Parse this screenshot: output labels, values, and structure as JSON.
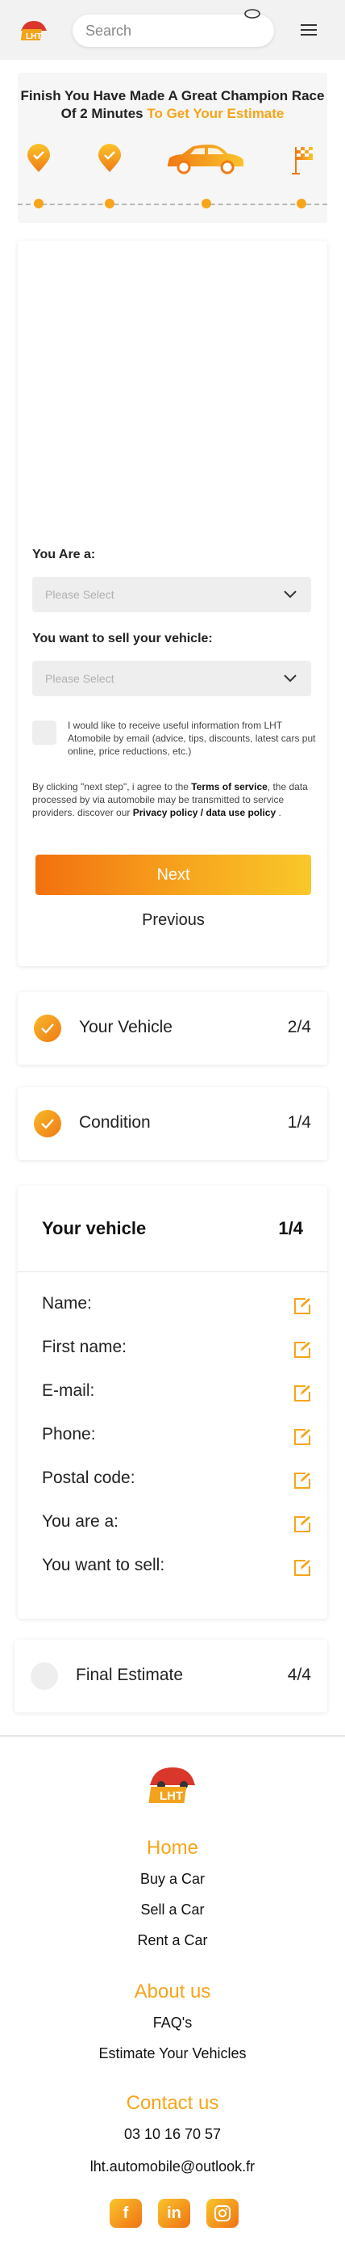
{
  "header": {
    "search_placeholder": "Search",
    "logo_icon": "lht-car-logo",
    "menu_icon": "hamburger-menu-icon"
  },
  "progress": {
    "title_main": "Finish You Have Made A Great Champion Race Of 2 Minutes",
    "title_highlight": "To Get Your Estimate",
    "accent_color": "#f5a51a"
  },
  "form": {
    "you_are_label": "You Are a:",
    "you_are_placeholder": "Please Select",
    "sell_label": "You want to sell your vehicle:",
    "sell_placeholder": "Please Select",
    "newsletter_text": "I would like to receive useful information from LHT Atomobile by email (advice, tips, discounts, latest cars put online, price reductions, etc.)",
    "legal_prefix": "By clicking \"next step\", i agree to the",
    "terms_link": "Terms of service",
    "legal_middle": ", the data processed by via automobile may be transmitted to service providers. discover our",
    "privacy_link": "Privacy policy / data use policy",
    "legal_suffix": ".",
    "next_label": "Next",
    "previous_label": "Previous"
  },
  "steps": [
    {
      "name": "Your Vehicle",
      "count": "2/4"
    },
    {
      "name": "Condition",
      "count": "1/4"
    }
  ],
  "vehicle": {
    "title": "Your vehicle",
    "count": "1/4",
    "fields": [
      "Name:",
      "First name:",
      "E-mail:",
      "Phone:",
      "Postal code:",
      "You are a:",
      "You want to sell:"
    ]
  },
  "final": {
    "name": "Final Estimate",
    "count": "4/4"
  },
  "footer": {
    "home": "Home",
    "buy": "Buy a Car",
    "sell": "Sell a Car",
    "rent": "Rent a Car",
    "about": "About us",
    "faq": "FAQ's",
    "estimate": "Estimate Your Vehicles",
    "contact": "Contact us",
    "phone": "03 10 16 70 57",
    "email": "lht.automobile@outlook.fr",
    "social": [
      "f",
      "in",
      "instagram"
    ]
  }
}
